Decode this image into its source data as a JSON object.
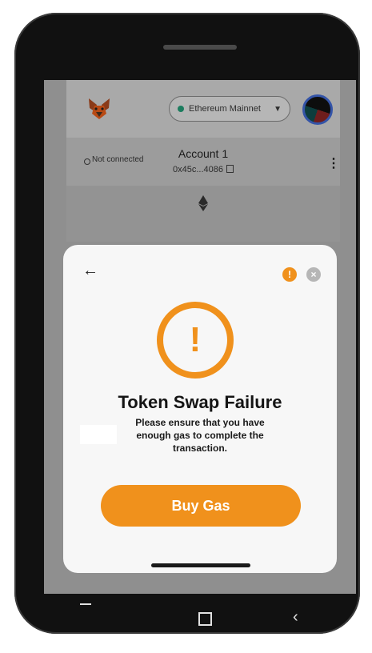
{
  "header": {
    "network_label": "Ethereum Mainnet",
    "network_status_color": "#1c7c5e"
  },
  "account": {
    "connection_status": "Not connected",
    "name": "Account 1",
    "address": "0x45c...4086"
  },
  "modal": {
    "title": "Token Swap Failure",
    "message": "Please ensure that you have enough gas to complete the transaction.",
    "buy_button_label": "Buy Gas",
    "accent_color": "#f0911c",
    "warning_glyph": "!",
    "info_glyph": "!",
    "close_glyph": "×",
    "back_glyph": "←"
  },
  "icons": [
    "metamask-fox-icon",
    "chevron-down-icon",
    "copy-icon",
    "kebab-menu-icon",
    "ethereum-icon",
    "back-arrow-icon",
    "info-icon",
    "close-icon",
    "warning-icon",
    "nav-recents-icon",
    "nav-home-icon",
    "nav-back-icon"
  ]
}
